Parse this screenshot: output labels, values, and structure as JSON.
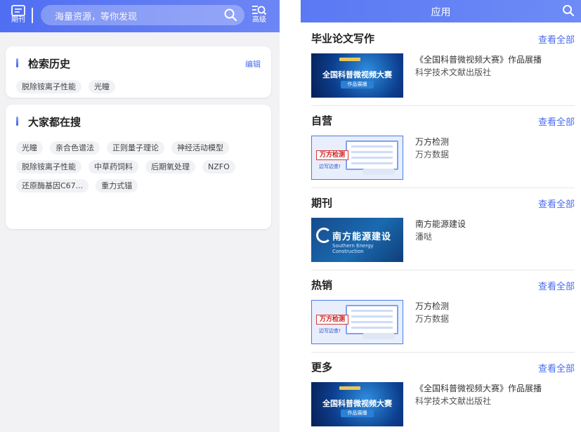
{
  "left": {
    "header": {
      "journal_label": "期刊",
      "search_placeholder": "海量资源，等你发现",
      "advanced_label": "高级",
      "icons": [
        "journal-icon",
        "search-icon",
        "advanced-search-icon"
      ],
      "colors": {
        "header_start": "#4f6ef2",
        "header_end": "#6d86f5"
      }
    },
    "history": {
      "title": "检索历史",
      "edit_label": "编辑",
      "chips": [
        "脱除铵离子性能",
        "光瞳"
      ]
    },
    "popular": {
      "title": "大家都在搜",
      "chips": [
        "光瞳",
        "亲合色谱法",
        "正则量子理论",
        "神经活动模型",
        "脱除铵离子性能",
        "中草药饲料",
        "后期氧处理",
        "NZFO",
        "还原酶基因C67...",
        "重力式锚"
      ]
    }
  },
  "right": {
    "header": {
      "title": "应用",
      "icon": "search-icon"
    },
    "sections": [
      {
        "title": "毕业论文写作",
        "see_all": "查看全部",
        "item": {
          "name": "《全国科普微视频大赛》作品展播",
          "publisher": "科学技术文献出版社",
          "thumb": {
            "text": "全国科普微视频大赛",
            "sub": "作品展播"
          }
        }
      },
      {
        "title": "自营",
        "see_all": "查看全部",
        "item": {
          "name": "万方检测",
          "publisher": "万方数据",
          "thumb": {
            "brand": "万方检测",
            "slogan": "边写边查!"
          }
        }
      },
      {
        "title": "期刊",
        "see_all": "查看全部",
        "item": {
          "name": "南方能源建设",
          "publisher": "潘哒",
          "thumb": {
            "cn": "南方能源建设",
            "en": "Southern Energy Construction"
          }
        }
      },
      {
        "title": "热销",
        "see_all": "查看全部",
        "item": {
          "name": "万方检测",
          "publisher": "万方数据",
          "thumb": {
            "brand": "万方检测",
            "slogan": "边写边查!"
          }
        }
      },
      {
        "title": "更多",
        "see_all": "查看全部",
        "item": {
          "name": "《全国科普微视频大赛》作品展播",
          "publisher": "科学技术文献出版社",
          "thumb": {
            "text": "全国科普微视频大赛",
            "sub": "作品展播"
          }
        }
      }
    ],
    "colors": {
      "accent": "#4a6cf0",
      "header": "#5a79f3"
    }
  }
}
